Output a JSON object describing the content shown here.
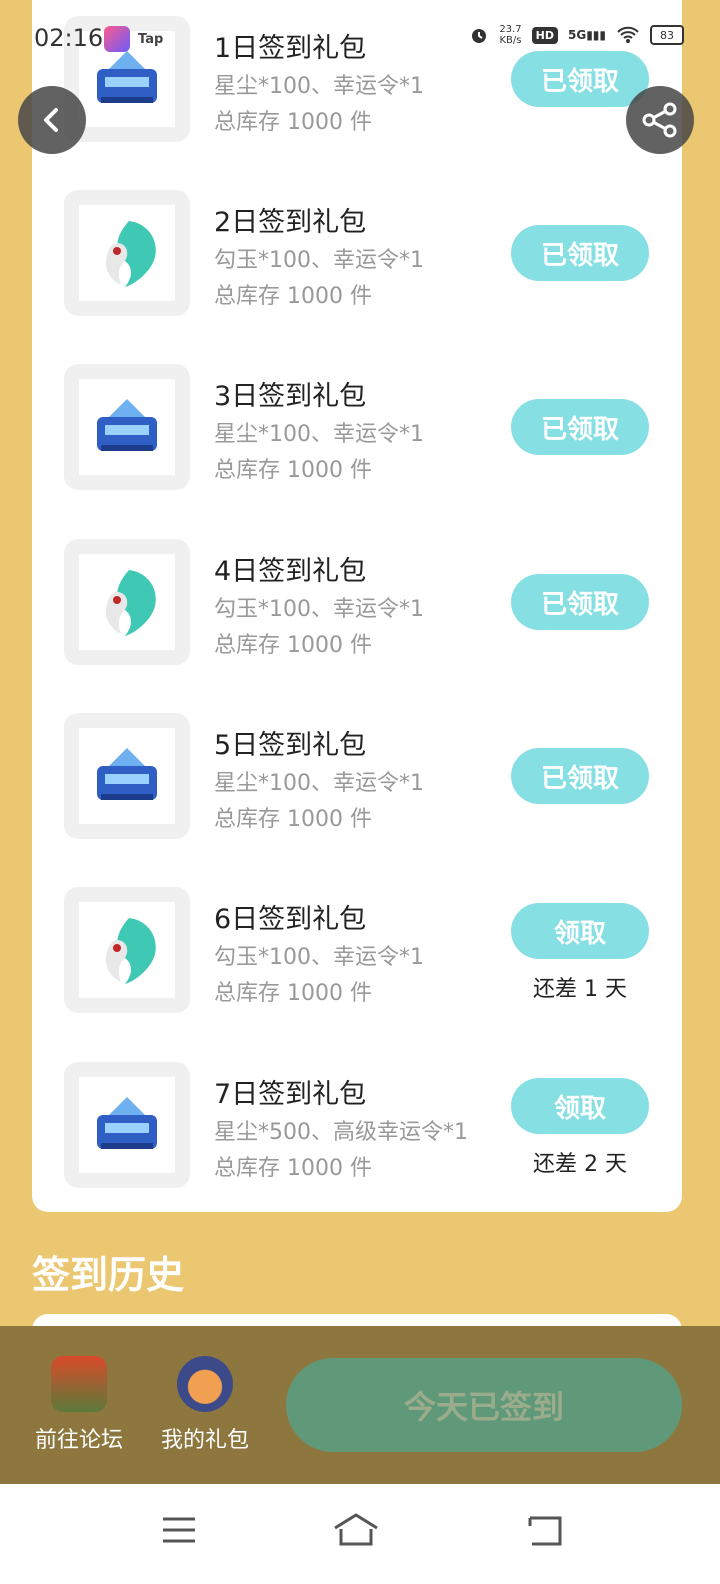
{
  "status_bar": {
    "time": "02:16",
    "tap_label": "Tap",
    "speed_value": "23.7",
    "speed_unit": "KB/s",
    "hd": "HD",
    "network": "5G",
    "battery": "83"
  },
  "gifts": [
    {
      "title": "1日签到礼包",
      "desc": "星尘*100、幸运令*1",
      "stock": "总库存 1000 件",
      "button": "已领取",
      "remain": "",
      "icon": "blue-crystal-chest-icon"
    },
    {
      "title": "2日签到礼包",
      "desc": "勾玉*100、幸运令*1",
      "stock": "总库存 1000 件",
      "button": "已领取",
      "remain": "",
      "icon": "jade-magatama-icon"
    },
    {
      "title": "3日签到礼包",
      "desc": "星尘*100、幸运令*1",
      "stock": "总库存 1000 件",
      "button": "已领取",
      "remain": "",
      "icon": "blue-crystal-chest-icon"
    },
    {
      "title": "4日签到礼包",
      "desc": "勾玉*100、幸运令*1",
      "stock": "总库存 1000 件",
      "button": "已领取",
      "remain": "",
      "icon": "jade-magatama-icon"
    },
    {
      "title": "5日签到礼包",
      "desc": "星尘*100、幸运令*1",
      "stock": "总库存 1000 件",
      "button": "已领取",
      "remain": "",
      "icon": "blue-crystal-chest-icon"
    },
    {
      "title": "6日签到礼包",
      "desc": "勾玉*100、幸运令*1",
      "stock": "总库存 1000 件",
      "button": "领取",
      "remain": "还差 1 天",
      "icon": "jade-magatama-icon"
    },
    {
      "title": "7日签到礼包",
      "desc": "星尘*500、高级幸运令*1",
      "stock": "总库存 1000 件",
      "button": "领取",
      "remain": "还差 2 天",
      "icon": "blue-crystal-chest-icon"
    }
  ],
  "history_title": "签到历史",
  "bottom_bar": {
    "forum_label": "前往论坛",
    "my_gift_label": "我的礼包",
    "signed_button": "今天已签到"
  },
  "colors": {
    "background": "#ecc772",
    "button_teal": "#86dfe3",
    "bottom_bar": "#8d773e",
    "signed_button": "#5f997a"
  }
}
